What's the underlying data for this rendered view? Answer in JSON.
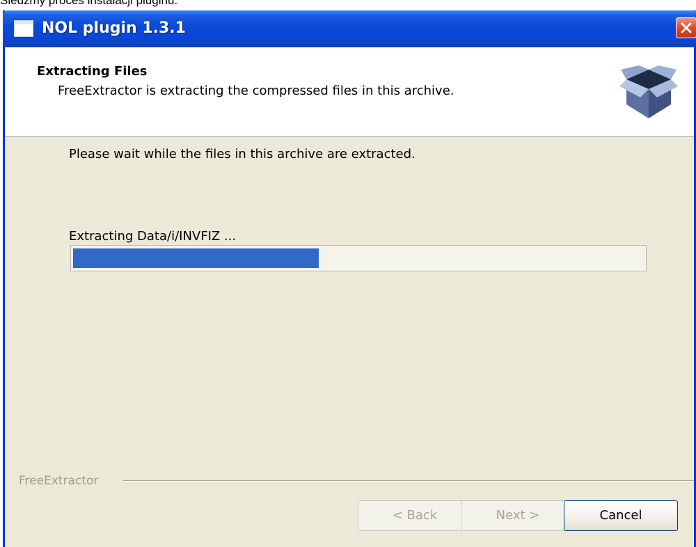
{
  "page_caption": "Śledźmy proces instalacji pluginu.",
  "window": {
    "title": "NOL plugin 1.3.1",
    "title_icon": "window-icon",
    "close_icon": "close-icon"
  },
  "header": {
    "title": "Extracting Files",
    "subtitle": "FreeExtractor is extracting the compressed files in this archive.",
    "icon": "open-box-icon"
  },
  "body": {
    "instruction": "Please wait while the files in this archive are extracted.",
    "status": "Extracting Data/i/INVFIZ ...",
    "progress_fraction": 0.43
  },
  "footer": {
    "brand": "FreeExtractor",
    "back_label": "< Back",
    "next_label": "Next >",
    "cancel_label": "Cancel"
  },
  "colors": {
    "titlebar": "#0a48d8",
    "progress_fill": "#316ac5",
    "dialog_bg": "#ece9d8",
    "close_button": "#e04420"
  }
}
